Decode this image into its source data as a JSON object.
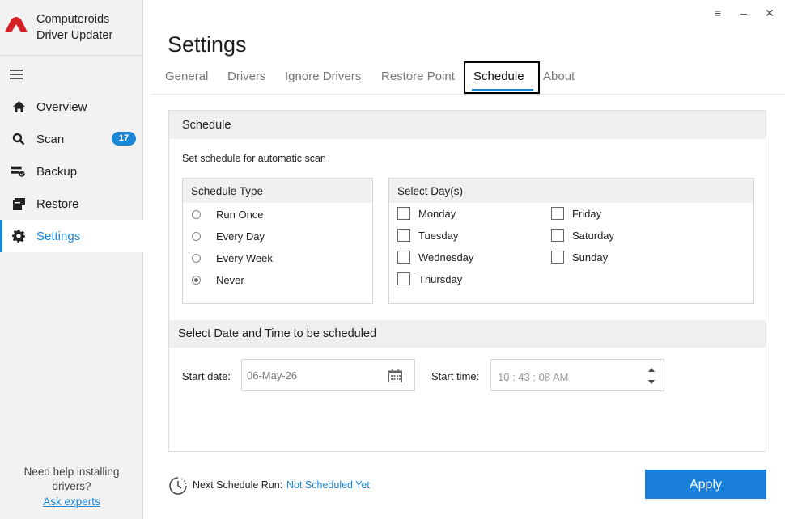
{
  "app": {
    "name": "Computeroids Driver Updater"
  },
  "window_controls": {
    "menu": "≡",
    "minimize": "–",
    "close": "✕"
  },
  "sidebar": {
    "items": [
      {
        "label": "Overview",
        "icon": "home-icon"
      },
      {
        "label": "Scan",
        "icon": "search-icon",
        "badge": "17"
      },
      {
        "label": "Backup",
        "icon": "backup-icon"
      },
      {
        "label": "Restore",
        "icon": "restore-icon"
      },
      {
        "label": "Settings",
        "icon": "gear-icon",
        "active": true
      }
    ],
    "help_text_1": "Need help installing",
    "help_text_2": "drivers?",
    "help_link": "Ask experts"
  },
  "page": {
    "title": "Settings"
  },
  "tabs": [
    "General",
    "Drivers",
    "Ignore Drivers",
    "Restore Point",
    "Schedule",
    "About"
  ],
  "active_tab": "Schedule",
  "schedule": {
    "heading": "Schedule",
    "subtitle": "Set schedule for automatic scan",
    "type_heading": "Schedule Type",
    "types": [
      "Run Once",
      "Every Day",
      "Every Week",
      "Never"
    ],
    "selected_type": "Never",
    "days_heading": "Select Day(s)",
    "days": [
      "Monday",
      "Tuesday",
      "Wednesday",
      "Thursday",
      "Friday",
      "Saturday",
      "Sunday"
    ],
    "datetime_heading": "Select Date and Time to be scheduled",
    "start_date_label": "Start date:",
    "start_date_value": "06-May-26",
    "start_time_label": "Start time:",
    "start_time_value": "10 : 43 : 08  AM"
  },
  "footer": {
    "next_label": "Next Schedule Run:",
    "next_value": "Not Scheduled Yet",
    "apply_label": "Apply"
  },
  "colors": {
    "accent": "#1a86d6",
    "logo": "#d81e25",
    "apply": "#1a7fd8"
  }
}
